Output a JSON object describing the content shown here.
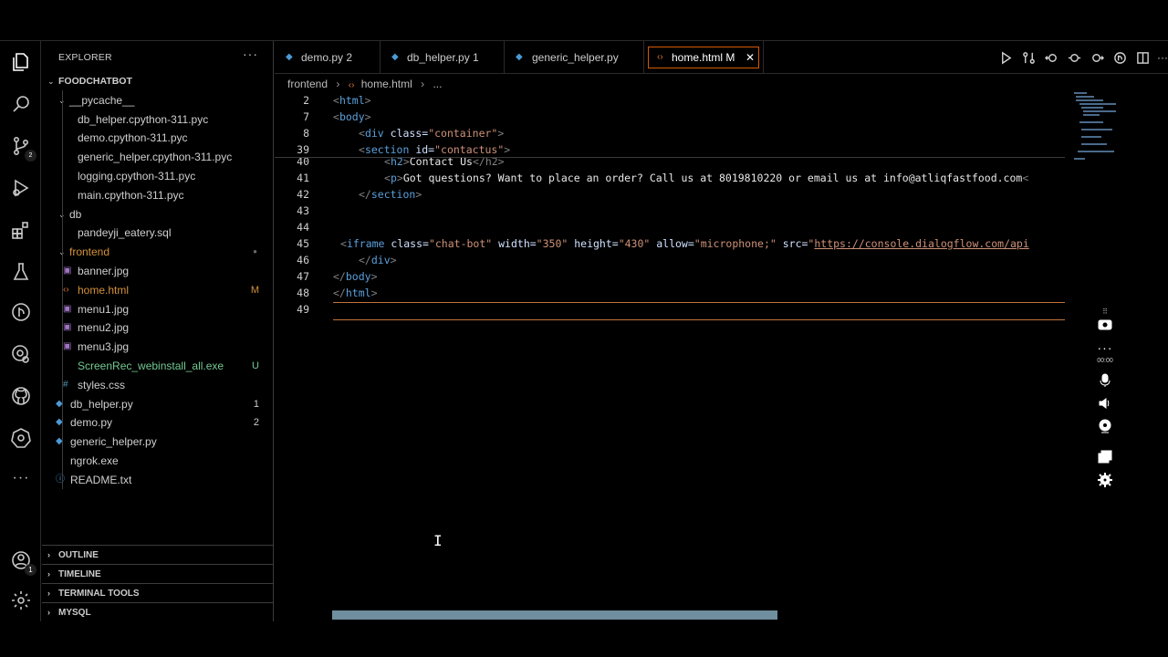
{
  "activity_bar": {
    "icons": [
      "explorer-icon",
      "search-icon",
      "source-control-icon",
      "run-debug-icon",
      "extensions-icon",
      "testing-icon",
      "git-graph-icon",
      "remote-explorer-icon",
      "github-icon",
      "kubernetes-icon",
      "more-icon"
    ],
    "bottom_icons": [
      "accounts-icon",
      "manage-gear-icon"
    ],
    "accounts_badge": "1"
  },
  "sidebar": {
    "title": "EXPLORER",
    "more": "···",
    "project": "FOODCHATBOT",
    "tree": [
      {
        "label": "__pycache__",
        "depth": 1,
        "folder": true,
        "open": true
      },
      {
        "label": "db_helper.cpython-311.pyc",
        "depth": 2
      },
      {
        "label": "demo.cpython-311.pyc",
        "depth": 2
      },
      {
        "label": "generic_helper.cpython-311.pyc",
        "depth": 2
      },
      {
        "label": "logging.cpython-311.pyc",
        "depth": 2
      },
      {
        "label": "main.cpython-311.pyc",
        "depth": 2
      },
      {
        "label": "db",
        "depth": 1,
        "folder": true,
        "open": true
      },
      {
        "label": "pandeyji_eatery.sql",
        "depth": 2
      },
      {
        "label": "frontend",
        "depth": 1,
        "folder": true,
        "open": true,
        "color": "#d4913a",
        "dot": true
      },
      {
        "label": "banner.jpg",
        "depth": 2,
        "icon": "image"
      },
      {
        "label": "home.html",
        "depth": 2,
        "icon": "html",
        "color": "#d4913a",
        "deco": "M",
        "deco_color": "#d4913a"
      },
      {
        "label": "menu1.jpg",
        "depth": 2,
        "icon": "image"
      },
      {
        "label": "menu2.jpg",
        "depth": 2,
        "icon": "image"
      },
      {
        "label": "menu3.jpg",
        "depth": 2,
        "icon": "image"
      },
      {
        "label": "ScreenRec_webinstall_all.exe",
        "depth": 2,
        "color": "#73c991",
        "deco": "U",
        "deco_color": "#73c991"
      },
      {
        "label": "styles.css",
        "depth": 2,
        "icon": "css"
      },
      {
        "label": "db_helper.py",
        "depth": 1,
        "icon": "python",
        "deco": "1",
        "deco_color": "#cccccc"
      },
      {
        "label": "demo.py",
        "depth": 1,
        "icon": "python",
        "deco": "2",
        "deco_color": "#cccccc"
      },
      {
        "label": "generic_helper.py",
        "depth": 1,
        "icon": "python"
      },
      {
        "label": "ngrok.exe",
        "depth": 1
      },
      {
        "label": "README.txt",
        "depth": 1,
        "icon": "info"
      }
    ],
    "sections": [
      "OUTLINE",
      "TIMELINE",
      "TERMINAL TOOLS",
      "MYSQL"
    ]
  },
  "tabs": [
    {
      "label": "demo.py 2",
      "icon": "python"
    },
    {
      "label": "db_helper.py 1",
      "icon": "python"
    },
    {
      "label": "generic_helper.py",
      "icon": "python"
    },
    {
      "label": "home.html M",
      "icon": "html",
      "active": true,
      "close": "✕"
    }
  ],
  "toolbar": [
    "run-icon",
    "compare-icon",
    "go-back-icon",
    "go-forward-icon",
    "open-changes-icon",
    "timeline-icon",
    "split-editor-icon",
    "more-actions-icon"
  ],
  "breadcrumb": {
    "folder": "frontend",
    "file": "home.html",
    "rest": "..."
  },
  "code": {
    "sticky": [
      {
        "num": "2",
        "indent": 0,
        "open": "<",
        "tag": "html",
        "close": ">"
      },
      {
        "num": "7",
        "indent": 0,
        "open": "<",
        "tag": "body",
        "close": ">"
      },
      {
        "num": "8",
        "indent": 1,
        "open": "<",
        "tag": "div",
        "attr": " class=",
        "val": "\"container\"",
        "close": ">"
      },
      {
        "num": "39",
        "indent": 1,
        "open": "<",
        "tag": "section",
        "attr": " id=",
        "val": "\"contactus\"",
        "close": ">"
      }
    ],
    "lines": [
      {
        "num": "40",
        "indent": 2,
        "open": "<",
        "tag": "h2",
        "close": ">",
        "text": "Contact Us",
        "end": "</h2>"
      },
      {
        "num": "41",
        "indent": 2,
        "open": "<",
        "tag": "p",
        "close": ">",
        "text": "Got questions? Want to place an order? Call us at 8019810220 or email us at info@atliqfastfood.com",
        "end": "<"
      },
      {
        "num": "42",
        "indent": 1,
        "open": "</",
        "tag": "section",
        "close": ">"
      },
      {
        "num": "43",
        "indent": 0
      },
      {
        "num": "44",
        "indent": 0
      },
      {
        "num": "45",
        "indent": 0,
        "iframe": true
      },
      {
        "num": "46",
        "indent": 1,
        "open": "</",
        "tag": "div",
        "close": ">"
      },
      {
        "num": "47",
        "indent": 0,
        "open": "</",
        "tag": "body",
        "close": ">"
      },
      {
        "num": "48",
        "indent": 0,
        "open": "</",
        "tag": "html",
        "close": ">"
      },
      {
        "num": "49",
        "indent": 0
      }
    ],
    "iframe": {
      "tag": "iframe",
      "a1": "class=",
      "v1": "\"chat-bot\"",
      "a2": "width=",
      "v2": "\"350\"",
      "a3": "height=",
      "v3": "\"430\"",
      "a4": "allow=",
      "v4": "\"microphone;\"",
      "a5": "src=",
      "v5": "\"",
      "url": "https://console.dialogflow.com/api"
    }
  },
  "recorder": {
    "time": "00:00",
    "buttons": [
      "drag-handle-icon",
      "camera-icon",
      "more-icon",
      "microphone-icon",
      "speaker-icon",
      "webcam-icon",
      "windows-icon",
      "settings-icon"
    ]
  },
  "colors": {
    "accent": "#d45a00",
    "modified": "#d4913a",
    "untracked": "#73c991",
    "html_tag": "#5aa0dc",
    "string": "#ce9178"
  }
}
